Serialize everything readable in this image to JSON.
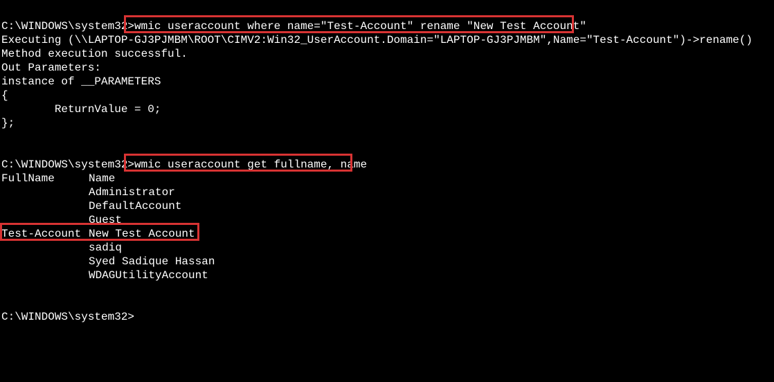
{
  "terminal": {
    "prompt": "C:\\WINDOWS\\system32>",
    "cmd1": "wmic useraccount where name=\"Test-Account\" rename \"New Test Account\"",
    "out1_line1": "Executing (\\\\LAPTOP-GJ3PJMBM\\ROOT\\CIMV2:Win32_UserAccount.Domain=\"LAPTOP-GJ3PJMBM\",Name=\"Test-Account\")->rename()",
    "out1_line2": "Method execution successful.",
    "out1_line3": "Out Parameters:",
    "out1_line4": "instance of __PARAMETERS",
    "out1_line5": "{",
    "out1_line6": "        ReturnValue = 0;",
    "out1_line7": "};",
    "cmd2": "wmic useraccount get fullname, name",
    "hdr_full": "FullName",
    "hdr_name": "Name",
    "row1_full": "",
    "row1_name": "Administrator",
    "row2_full": "",
    "row2_name": "DefaultAccount",
    "row3_full": "",
    "row3_name": "Guest",
    "row4_full": "Test-Account",
    "row4_name": "New Test Account",
    "row5_full": "",
    "row5_name": "sadiq",
    "row6_full": "",
    "row6_name": "Syed Sadique Hassan",
    "row7_full": "",
    "row7_name": "WDAGUtilityAccount"
  },
  "annotations": {
    "highlight1": "highlight-cmd-rename",
    "highlight2": "highlight-cmd-get",
    "highlight3": "highlight-row-result"
  }
}
